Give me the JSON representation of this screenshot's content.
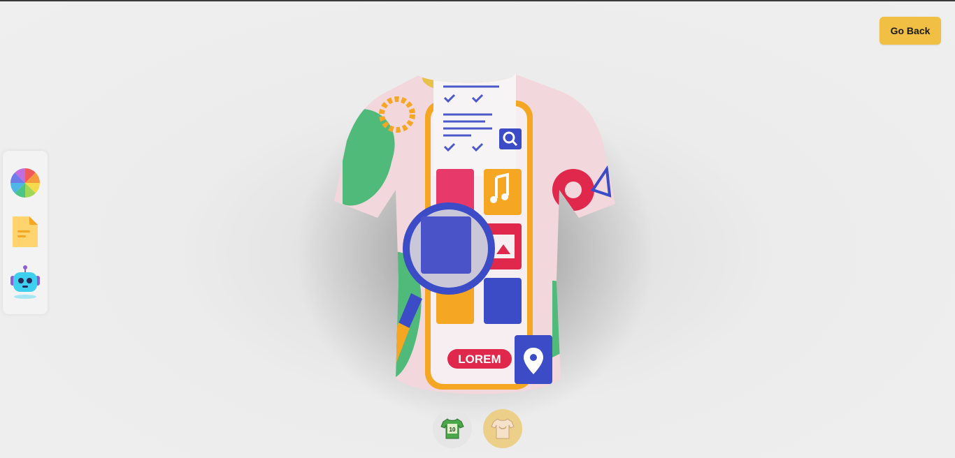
{
  "header": {
    "go_back_label": "Go Back"
  },
  "toolbar": {
    "items": [
      {
        "name": "color-picker",
        "icon": "color-wheel-icon"
      },
      {
        "name": "file-picker",
        "icon": "file-icon"
      },
      {
        "name": "ai-picker",
        "icon": "robot-icon"
      }
    ]
  },
  "shirt": {
    "decal_text": "LOREM"
  },
  "filter_tabs": [
    {
      "name": "logo-shirt",
      "icon": "jersey-icon",
      "jersey_number": "10",
      "active": false
    },
    {
      "name": "full-texture-shirt",
      "icon": "stylish-shirt-icon",
      "active": true
    }
  ],
  "colors": {
    "accent": "#f2bf45",
    "shirt_base": "#f2d7dd"
  }
}
